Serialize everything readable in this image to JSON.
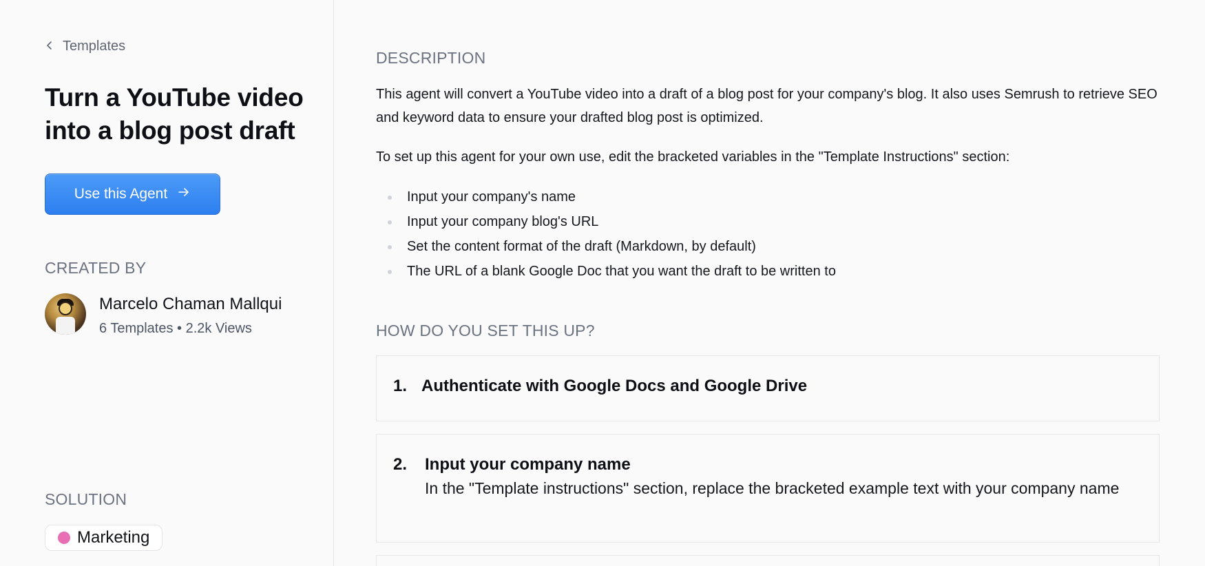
{
  "sidebar": {
    "back_label": "Templates",
    "title": "Turn a YouTube video into a blog post draft",
    "cta_label": "Use this Agent",
    "created_by_label": "CREATED BY",
    "creator": {
      "name": "Marcelo Chaman Mallqui",
      "stats": "6 Templates • 2.2k Views"
    },
    "solution_label": "SOLUTION",
    "solution_tag": {
      "label": "Marketing",
      "color": "#e86fb3"
    }
  },
  "main": {
    "description_heading": "DESCRIPTION",
    "description_p1": "This agent will convert a YouTube video into a draft of a blog post for your company's blog. It also uses Semrush to retrieve SEO and keyword data to ensure your drafted blog post is optimized.",
    "description_p2": "To set up this agent for your own use, edit the bracketed variables in the \"Template Instructions\" section:",
    "bullets": [
      "Input your company's name",
      "Input your company blog's URL",
      "Set the content format of the draft (Markdown, by default)",
      "The URL of a blank Google Doc that you want the draft to be written to"
    ],
    "setup_heading": "HOW DO YOU SET THIS UP?",
    "steps": [
      {
        "number": "1.",
        "title": "Authenticate with Google Docs and Google Drive"
      },
      {
        "number": "2.",
        "title": "Input your company name",
        "body": "In the \"Template instructions\" section, replace the bracketed example text with your company name"
      }
    ]
  },
  "colors": {
    "accent": "#2d7ff0",
    "muted_text": "#6b7280",
    "border": "#e6e7ea"
  }
}
